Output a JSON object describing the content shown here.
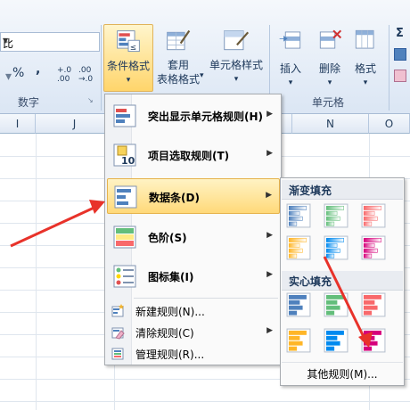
{
  "ribbon": {
    "number_format_value": "比",
    "percent": "%",
    "comma": ",",
    "dec_inc": "+.0→.00",
    "dec_dec": ".00→.0",
    "group_number": "数字",
    "conditional_formatting": "条件格式",
    "conditional_dropdown": "▾",
    "apply_table_label1": "套用",
    "apply_table_label2": "表格格式",
    "cell_styles": "单元格样式",
    "insert": "插入",
    "delete": "删除",
    "format": "格式",
    "group_cells": "单元格",
    "sigma": "Σ"
  },
  "grid": {
    "columns": [
      "I",
      "J",
      "N",
      "O"
    ]
  },
  "menu": {
    "items": [
      {
        "label": "突出显示单元格规则(H)"
      },
      {
        "label": "项目选取规则(T)"
      },
      {
        "label": "数据条(D)"
      },
      {
        "label": "色阶(S)"
      },
      {
        "label": "图标集(I)"
      }
    ],
    "small_items": [
      {
        "label": "新建规则(N)..."
      },
      {
        "label": "清除规则(C)"
      },
      {
        "label": "管理规则(R)..."
      }
    ]
  },
  "submenu": {
    "gradient_header": "渐变填充",
    "solid_header": "实心填充",
    "other_rules": "其他规则(M)...",
    "bar_colors": [
      "#4f81bd",
      "#63be7b",
      "#f8696b",
      "#ffb628",
      "#008aef",
      "#d6007b"
    ]
  }
}
